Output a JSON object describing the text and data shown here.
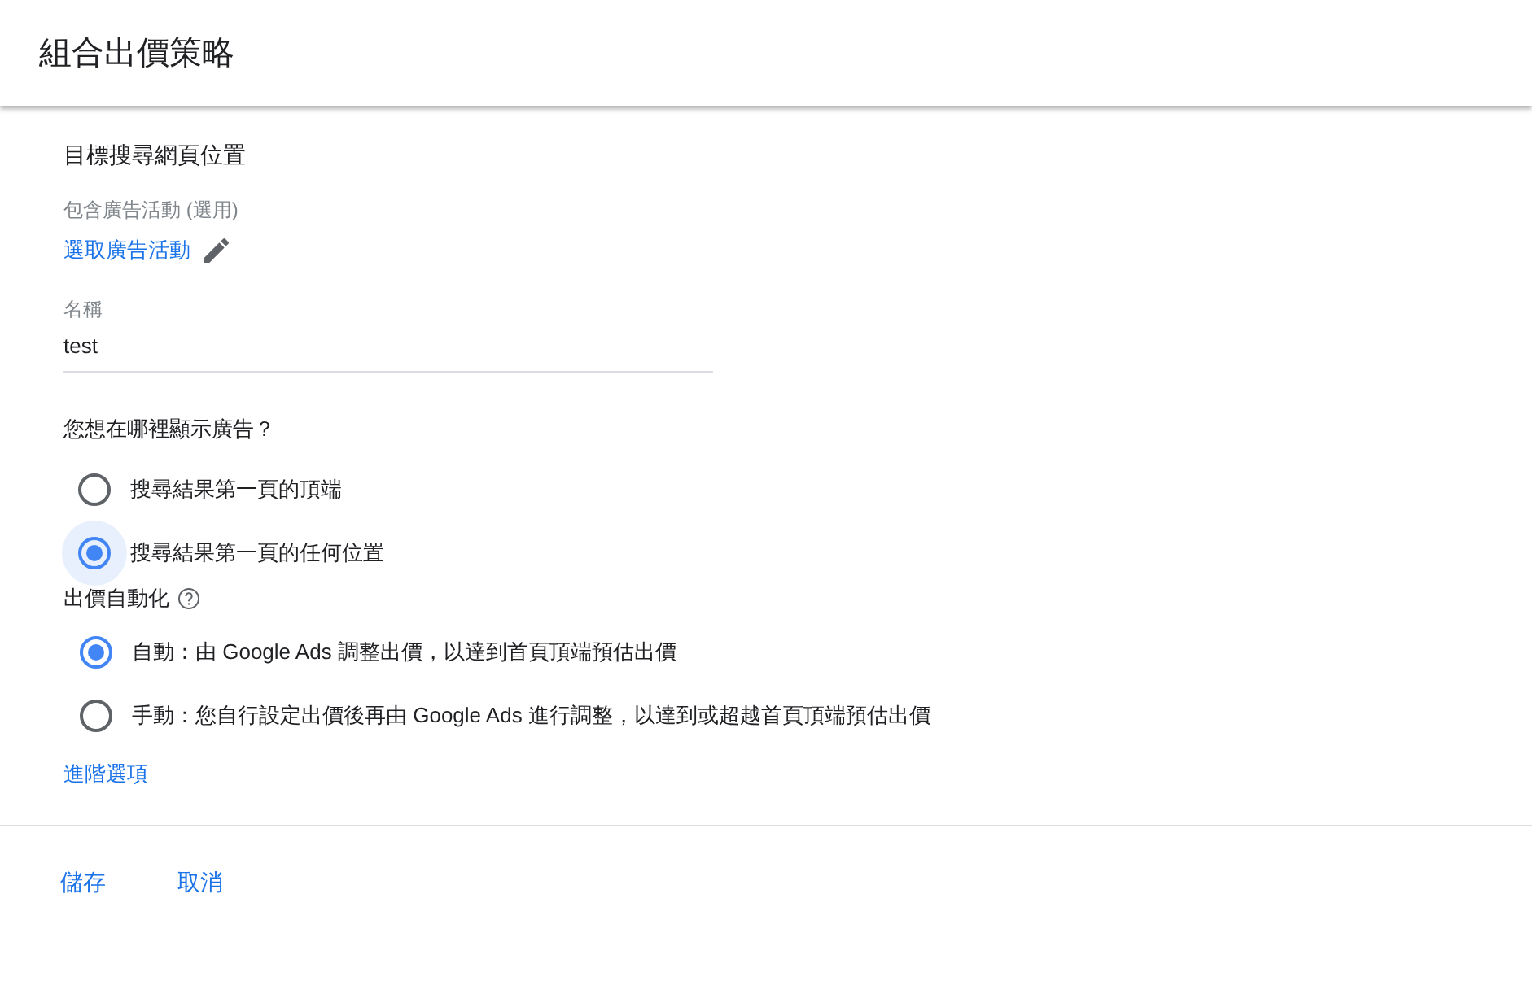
{
  "header": {
    "title": "組合出價策略"
  },
  "section_title": "目標搜尋網頁位置",
  "campaigns": {
    "label": "包含廣告活動 (選用)",
    "link": "選取廣告活動"
  },
  "name_field": {
    "label": "名稱",
    "value": "test"
  },
  "location": {
    "question": "您想在哪裡顯示廣告？",
    "options": [
      {
        "label": "搜尋結果第一頁的頂端",
        "selected": false,
        "focused": false
      },
      {
        "label": "搜尋結果第一頁的任何位置",
        "selected": true,
        "focused": true
      }
    ]
  },
  "automation": {
    "label": "出價自動化",
    "options": [
      {
        "label": "自動：由 Google Ads 調整出價，以達到首頁頂端預估出價",
        "selected": true,
        "focused": false
      },
      {
        "label": "手動：您自行設定出價後再由 Google Ads 進行調整，以達到或超越首頁頂端預估出價",
        "selected": false,
        "focused": false
      }
    ]
  },
  "advanced_link": "進階選項",
  "buttons": [
    "儲存",
    "取消"
  ]
}
